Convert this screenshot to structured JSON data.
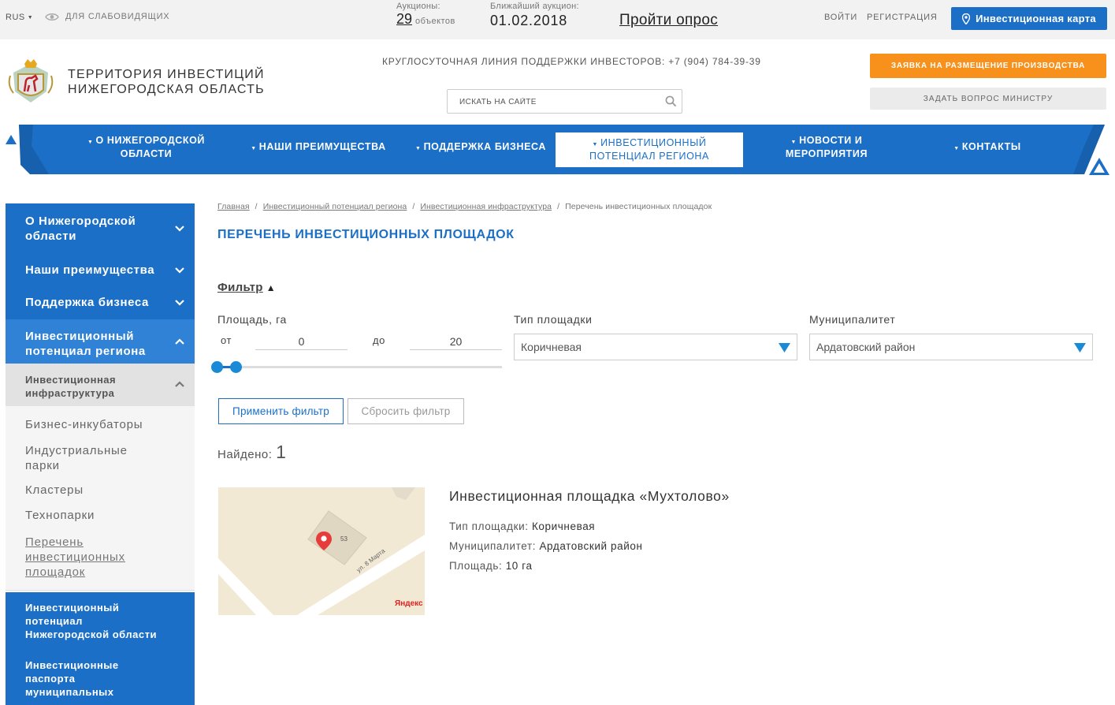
{
  "topbar": {
    "lang": "RUS",
    "low_vision": "ДЛЯ СЛАБОВИДЯЩИХ",
    "auctions_label": "Аукционы:",
    "auctions_count": "29",
    "auctions_unit": "объектов",
    "nearest_label": "Ближайший аукцион:",
    "nearest_date": "01.02.2018",
    "survey": "Пройти опрос",
    "login": "ВОЙТИ",
    "register": "РЕГИСТРАЦИЯ",
    "invest_map": "Инвестиционная карта"
  },
  "header": {
    "title_line1": "ТЕРРИТОРИЯ ИНВЕСТИЦИЙ",
    "title_line2": "НИЖЕГОРОДСКАЯ ОБЛАСТЬ",
    "hotline": "КРУГЛОСУТОЧНАЯ ЛИНИЯ ПОДДЕРЖКИ ИНВЕСТОРОВ: +7 (904) 784-39-39",
    "search_placeholder": "ИСКАТЬ НА САЙТЕ",
    "btn_production": "ЗАЯВКА НА РАЗМЕЩЕНИЕ ПРОИЗВОДСТВА",
    "btn_ask": "ЗАДАТЬ ВОПРОС МИНИСТРУ"
  },
  "nav": {
    "items": [
      {
        "line1": "О НИЖЕГОРОДСКОЙ",
        "line2": "ОБЛАСТИ"
      },
      {
        "line1": "НАШИ ПРЕИМУЩЕСТВА",
        "line2": ""
      },
      {
        "line1": "ПОДДЕРЖКА БИЗНЕСА",
        "line2": ""
      },
      {
        "line1": "ИНВЕСТИЦИОННЫЙ",
        "line2": "ПОТЕНЦИАЛ РЕГИОНА"
      },
      {
        "line1": "НОВОСТИ И",
        "line2": "МЕРОПРИЯТИЯ"
      },
      {
        "line1": "КОНТАКТЫ",
        "line2": ""
      }
    ]
  },
  "sidebar": {
    "top_items": [
      {
        "line1": "О Нижегородской",
        "line2": "области"
      },
      {
        "line1": "Наши преимущества",
        "line2": ""
      },
      {
        "line1": "Поддержка бизнеса",
        "line2": ""
      },
      {
        "line1": "Инвестиционный",
        "line2": "потенциал региона"
      }
    ],
    "sub": {
      "line1": "Инвестиционная",
      "line2": "инфраструктура"
    },
    "links": [
      {
        "line1": "Бизнес-инкубаторы",
        "line2": "",
        "line3": ""
      },
      {
        "line1": "Индустриальные",
        "line2": "парки",
        "line3": ""
      },
      {
        "line1": "Кластеры",
        "line2": "",
        "line3": ""
      },
      {
        "line1": "Технопарки",
        "line2": "",
        "line3": ""
      },
      {
        "line1": "Перечень",
        "line2": "инвестиционных",
        "line3": "площадок"
      }
    ],
    "bottom_items": [
      {
        "line1": "Инвестиционный",
        "line2": "потенциал",
        "line3": "Нижегородской области"
      },
      {
        "line1": "Инвестиционные",
        "line2": "паспорта",
        "line3": "муниципальных"
      }
    ]
  },
  "breadcrumb": [
    "Главная",
    "Инвестиционный потенциал региона",
    "Инвестиционная инфраструктура",
    "Перечень инвестиционных площадок"
  ],
  "page_title": "ПЕРЕЧЕНЬ ИНВЕСТИЦИОННЫХ ПЛОЩАДОК",
  "filter": {
    "toggle": "Фильтр",
    "area_label": "Площадь, га",
    "from_label": "от",
    "from_value": "0",
    "to_label": "до",
    "to_value": "20",
    "type_label": "Тип площадки",
    "type_value": "Коричневая",
    "municipality_label": "Муниципалитет",
    "municipality_value": "Ардатовский район",
    "apply": "Применить фильтр",
    "reset": "Сбросить фильтр"
  },
  "found_label": "Найдено:",
  "found_count": "1",
  "result": {
    "title": "Инвестиционная площадка «Мухтолово»",
    "type_label": "Тип площадки:",
    "type_value": "Коричневая",
    "municipality_label": "Муниципалитет:",
    "municipality_value": "Ардатовский район",
    "area_label": "Площадь:",
    "area_value": "10 га",
    "map_street": "ул. 8 Марта",
    "map_house": "53",
    "map_brand": "Яндекс"
  },
  "colors": {
    "primary": "#1b6fc6",
    "accent_orange": "#f7911c",
    "nav_blue": "#1b6fc6"
  }
}
